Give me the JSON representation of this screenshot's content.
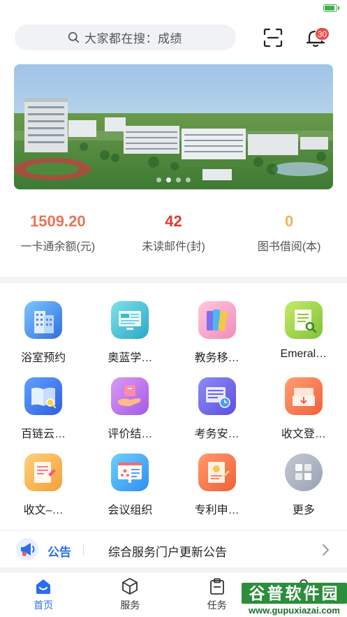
{
  "status_bar": {
    "battery_level": 0.85,
    "battery_color": "#3fb34f"
  },
  "header": {
    "search_placeholder": "大家都在搜：成绩",
    "notification_count": "30"
  },
  "banner": {
    "slide_count": 4,
    "active_slide": 1
  },
  "stats": [
    {
      "value": "1509.20",
      "label": "一卡通余额(元)",
      "color": "#e9735a"
    },
    {
      "value": "42",
      "label": "未读邮件(封)",
      "color": "#e23a2e"
    },
    {
      "value": "0",
      "label": "图书借阅(本)",
      "color": "#f1b25a"
    }
  ],
  "apps": [
    {
      "label": "浴室预约",
      "icon": "building-icon"
    },
    {
      "label": "奥蓝学…",
      "icon": "monitor-icon"
    },
    {
      "label": "教务移…",
      "icon": "books-icon"
    },
    {
      "label": "Emeral…",
      "icon": "document-search-icon"
    },
    {
      "label": "百链云…",
      "icon": "open-book-icon"
    },
    {
      "label": "评价结…",
      "icon": "hand-box-icon"
    },
    {
      "label": "考务安…",
      "icon": "schedule-icon"
    },
    {
      "label": "收文登…",
      "icon": "inbox-icon"
    },
    {
      "label": "收文–…",
      "icon": "notepad-icon"
    },
    {
      "label": "会议组织",
      "icon": "meeting-board-icon"
    },
    {
      "label": "专利申…",
      "icon": "patent-icon"
    },
    {
      "label": "更多",
      "icon": "more-grid-icon"
    }
  ],
  "notice": {
    "tag": "公告",
    "text": "综合服务门户更新公告"
  },
  "tabs": [
    {
      "label": "首页",
      "icon": "home-icon",
      "active": true
    },
    {
      "label": "服务",
      "icon": "cube-icon",
      "active": false
    },
    {
      "label": "任务",
      "icon": "clipboard-icon",
      "active": false
    },
    {
      "label": "",
      "icon": "profile-icon",
      "active": false
    }
  ],
  "watermark": {
    "title": "谷普软件园",
    "url": "www.gupuxiazai.com"
  },
  "colors": {
    "accent": "#2a6ef0",
    "badge": "#ea4a4a"
  }
}
